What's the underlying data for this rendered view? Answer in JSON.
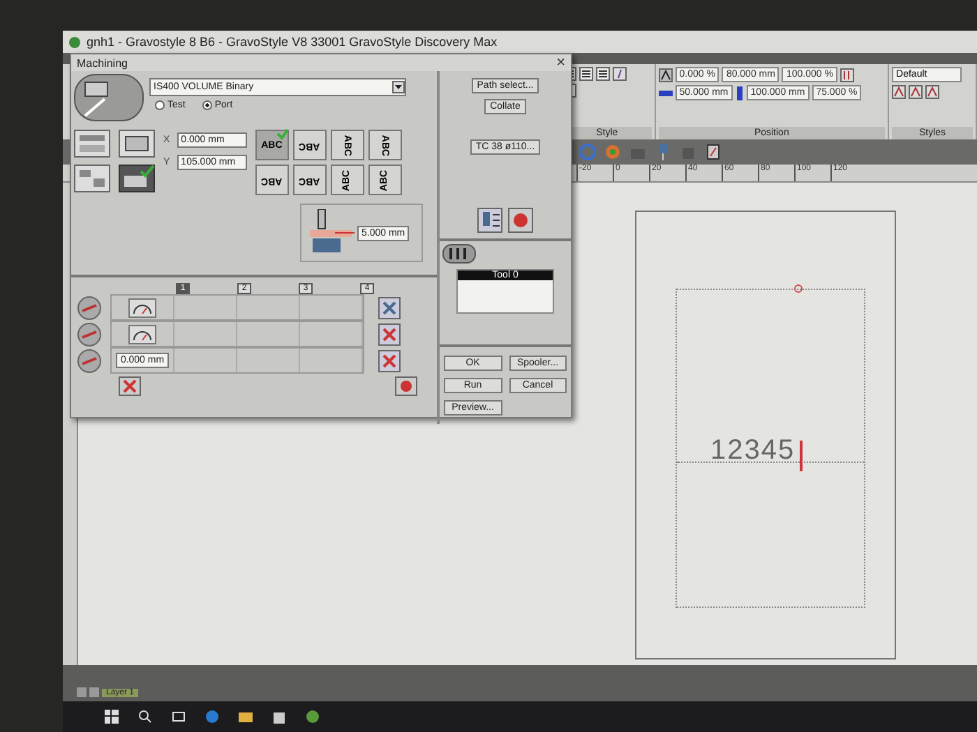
{
  "app": {
    "title": "gnh1 - Gravostyle 8 B6 - GravoStyle V8 33001 GravoStyle Discovery Max"
  },
  "ribbon": {
    "style_group": {
      "label": "Style"
    },
    "position_group": {
      "label": "Position",
      "row_1": [
        "0.000 %",
        "80.000 mm",
        "100.000 %"
      ],
      "row_2": [
        "50.000 mm",
        "100.000 mm",
        "75.000 %"
      ]
    },
    "styles_group": {
      "label": "Styles",
      "dropdown": "Default"
    }
  },
  "ruler": {
    "labels": [
      "-20",
      "0",
      "20",
      "40",
      "60",
      "80",
      "100",
      "120"
    ]
  },
  "canvas": {
    "text": "12345"
  },
  "status_bar": {
    "layer_tab": "Layer 1"
  },
  "dialog": {
    "title": "Machining",
    "close": "×",
    "machine": "IS400 VOLUME Binary",
    "modes": [
      {
        "label": "Test",
        "selected": false
      },
      {
        "label": "Port",
        "selected": true
      }
    ],
    "x": {
      "label": "X",
      "value": "0.000 mm"
    },
    "y": {
      "label": "Y",
      "value": "105.000 mm"
    },
    "orientations": [
      {
        "label": "ABC",
        "kind": "normal",
        "selected": true
      },
      {
        "label": "ABC",
        "kind": "rotate180",
        "selected": false
      },
      {
        "label": "ABC",
        "kind": "rot-cw",
        "selected": false
      },
      {
        "label": "ABC",
        "kind": "rot-cw",
        "selected": false
      },
      {
        "label": "ABC",
        "kind": "rotate180",
        "selected": false
      },
      {
        "label": "ABC",
        "kind": "rotate180",
        "selected": false
      },
      {
        "label": "ABC",
        "kind": "rot-ccw",
        "selected": false
      },
      {
        "label": "ABC",
        "kind": "rot-ccw",
        "selected": false
      }
    ],
    "side_buttons": [
      "Path select...",
      "Collate",
      "TC 38 ø110..."
    ],
    "depth": "5.000 mm",
    "columns": [
      {
        "label": "1",
        "selected": true
      },
      {
        "label": "2",
        "selected": false
      },
      {
        "label": "3",
        "selected": false
      },
      {
        "label": "4",
        "selected": false
      }
    ],
    "offset": "0.000 mm",
    "tools": [
      {
        "label": "Tool 0",
        "selected": true
      }
    ],
    "buttons": [
      "OK",
      "Spooler...",
      "Run",
      "Cancel",
      "Preview..."
    ]
  }
}
